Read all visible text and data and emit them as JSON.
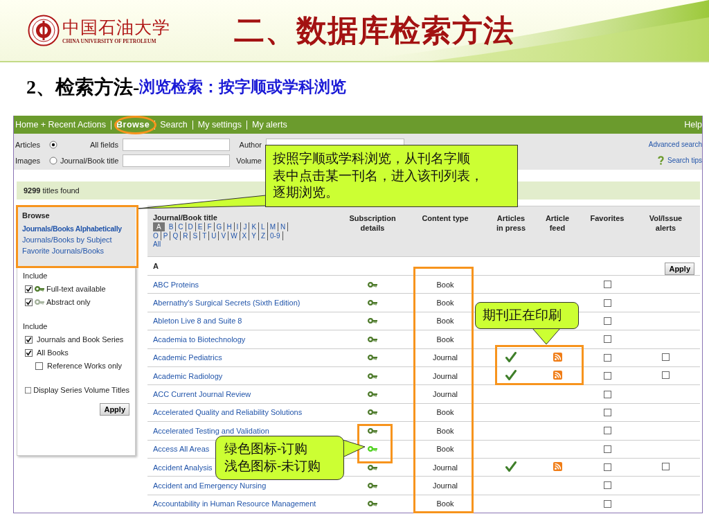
{
  "slide": {
    "logo": {
      "name_cn": "中国石油大学",
      "name_en": "CHINA UNIVERSITY OF PETROLEUM"
    },
    "title": "二、数据库检索方法",
    "subtitle": {
      "label": "2、检索方法-",
      "text": "浏览检索：按字顺或学科浏览"
    }
  },
  "site": {
    "nav": [
      {
        "label": "Home + Recent Actions",
        "selected": false
      },
      {
        "label": "Browse",
        "selected": true
      },
      {
        "label": "Search",
        "selected": false
      },
      {
        "label": "My settings",
        "selected": false
      },
      {
        "label": "My alerts",
        "selected": false
      }
    ],
    "help": "Help",
    "search": {
      "types": [
        {
          "label": "Articles",
          "selected": true
        },
        {
          "label": "Images",
          "selected": false
        }
      ],
      "fields": [
        {
          "label": "All fields"
        },
        {
          "label": "Journal/Book title"
        }
      ],
      "fields_2": [
        {
          "label": "Author"
        },
        {
          "label": "Volume"
        }
      ],
      "advanced": "Advanced search",
      "tips": "Search tips"
    },
    "results": "**9299** titles found",
    "sidebar": {
      "heading": "Browse",
      "links": [
        {
          "label": "Journals/Books Alphabetically",
          "selected": true
        },
        {
          "label": "Journals/Books by Subject",
          "selected": false
        },
        {
          "label": "Favorite Journals/Books",
          "selected": false
        }
      ],
      "access": {
        "heading": "Include",
        "options": [
          {
            "label": "Full-text available",
            "checked": true,
            "kind": "full"
          },
          {
            "label": "Abstract only",
            "checked": true,
            "kind": "abstract"
          }
        ]
      },
      "types": {
        "heading": "Include",
        "options": [
          {
            "label": "Journals and Book Series",
            "checked": true
          },
          {
            "label": "All Books",
            "checked": true,
            "children": [
              {
                "label": "Reference Works only",
                "checked": false
              }
            ]
          }
        ]
      },
      "display": {
        "label": "Display Series Volume Titles",
        "checked": false
      },
      "apply": "Apply"
    },
    "table": {
      "columns": [
        "Journal/Book title",
        "Subscription details",
        "Content type",
        "Articles in press",
        "Article feed",
        "Favorites",
        "Vol/Issue alerts"
      ],
      "letter_rows": [
        [
          {
            "label": "A",
            "selected": true
          },
          {
            "label": "B",
            "selected": false
          },
          {
            "label": "C",
            "selected": false
          },
          {
            "label": "D",
            "selected": false
          },
          {
            "label": "E",
            "selected": false
          },
          {
            "label": "F",
            "selected": false
          },
          {
            "label": "G",
            "selected": false
          },
          {
            "label": "H",
            "selected": false
          },
          {
            "label": "I",
            "selected": false
          },
          {
            "label": "J",
            "selected": false
          },
          {
            "label": "K",
            "selected": false
          },
          {
            "label": "L",
            "selected": false
          },
          {
            "label": "M",
            "selected": false
          },
          {
            "label": "N",
            "selected": false
          }
        ],
        [
          {
            "label": "O",
            "selected": false
          },
          {
            "label": "P",
            "selected": false
          },
          {
            "label": "Q",
            "selected": false
          },
          {
            "label": "R",
            "selected": false
          },
          {
            "label": "S",
            "selected": false
          },
          {
            "label": "T",
            "selected": false
          },
          {
            "label": "U",
            "selected": false
          },
          {
            "label": "V",
            "selected": false
          },
          {
            "label": "W",
            "selected": false
          },
          {
            "label": "X",
            "selected": false
          },
          {
            "label": "Y",
            "selected": false
          },
          {
            "label": "Z",
            "selected": false
          },
          {
            "label": "0-9",
            "selected": false
          }
        ]
      ],
      "all": "All",
      "section": "A",
      "apply": "Apply",
      "rows": [
        {
          "title": "ABC Proteins",
          "subscribed": true,
          "content_type": "Book",
          "in_press": false,
          "feed": false,
          "favorite": false,
          "has_alert": false
        },
        {
          "title": "Abernathy's Surgical Secrets (Sixth Edition)",
          "subscribed": true,
          "content_type": "Book",
          "in_press": false,
          "feed": false,
          "favorite": false,
          "has_alert": false
        },
        {
          "title": "Ableton Live 8 and Suite 8",
          "subscribed": true,
          "content_type": "Book",
          "in_press": false,
          "feed": false,
          "favorite": false,
          "has_alert": false
        },
        {
          "title": "Academia to Biotechnology",
          "subscribed": true,
          "content_type": "Book",
          "in_press": false,
          "feed": false,
          "favorite": false,
          "has_alert": false
        },
        {
          "title": "Academic Pediatrics",
          "subscribed": true,
          "content_type": "Journal",
          "in_press": true,
          "feed": true,
          "favorite": false,
          "has_alert": true
        },
        {
          "title": "Academic Radiology",
          "subscribed": true,
          "content_type": "Journal",
          "in_press": true,
          "feed": true,
          "favorite": false,
          "has_alert": true
        },
        {
          "title": "ACC Current Journal Review",
          "subscribed": true,
          "content_type": "Journal",
          "in_press": false,
          "feed": false,
          "favorite": false,
          "has_alert": false
        },
        {
          "title": "Accelerated Quality and Reliability Solutions",
          "subscribed": true,
          "content_type": "Book",
          "in_press": false,
          "feed": false,
          "favorite": false,
          "has_alert": false
        },
        {
          "title": "Accelerated Testing and Validation",
          "subscribed": true,
          "content_type": "Book",
          "in_press": false,
          "feed": false,
          "favorite": false,
          "has_alert": false
        },
        {
          "title": "Access All Areas",
          "subscribed": false,
          "content_type": "Book",
          "in_press": false,
          "feed": false,
          "favorite": false,
          "has_alert": false
        },
        {
          "title": "Accident Analysis",
          "subscribed": true,
          "content_type": "Journal",
          "in_press": true,
          "feed": true,
          "favorite": false,
          "has_alert": true
        },
        {
          "title": "Accident and Emergency Nursing",
          "subscribed": true,
          "content_type": "Journal",
          "in_press": false,
          "feed": false,
          "favorite": false,
          "has_alert": false
        },
        {
          "title": "Accountability in Human Resource Management",
          "subscribed": true,
          "content_type": "Book",
          "in_press": false,
          "feed": false,
          "favorite": false,
          "has_alert": false
        }
      ]
    }
  },
  "callouts": [
    {
      "lines": [
        "按照字顺或学科浏览，从刊名字顺",
        "表中点击某一刊名，进入该刊列表，",
        "逐期浏览。"
      ]
    },
    {
      "lines": [
        "期刊正在印刷"
      ]
    },
    {
      "lines": [
        "绿色图标-订购",
        "浅色图标-未订购"
      ]
    }
  ]
}
